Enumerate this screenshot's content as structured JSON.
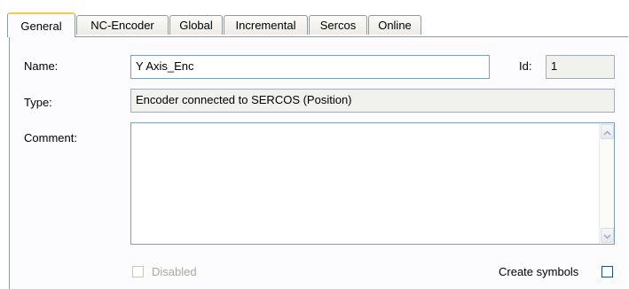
{
  "tabs": [
    {
      "label": "General",
      "active": true
    },
    {
      "label": "NC-Encoder",
      "active": false
    },
    {
      "label": "Global",
      "active": false
    },
    {
      "label": "Incremental",
      "active": false
    },
    {
      "label": "Sercos",
      "active": false
    },
    {
      "label": "Online",
      "active": false
    }
  ],
  "form": {
    "name_label": "Name:",
    "name_value": "Y Axis_Enc",
    "id_label": "Id:",
    "id_value": "1",
    "type_label": "Type:",
    "type_value": "Encoder connected to SERCOS (Position)",
    "comment_label": "Comment:",
    "comment_value": "",
    "disabled_label": "Disabled",
    "disabled_checked": false,
    "create_symbols_label": "Create symbols",
    "create_symbols_checked": false
  },
  "icons": {
    "scroll_up": "chevron-up-icon",
    "scroll_down": "chevron-down-icon"
  },
  "colors": {
    "active_tab_accent": "#ffc83c",
    "field_border": "#7f9db9",
    "panel_border": "#919b9c"
  }
}
